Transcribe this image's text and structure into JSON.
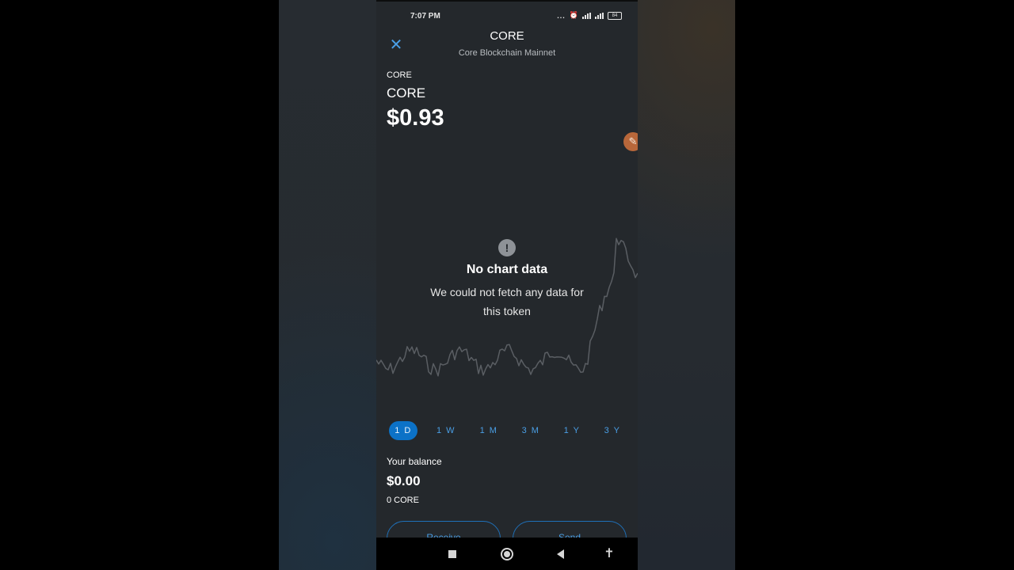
{
  "status_bar": {
    "time": "7:07 PM",
    "more": "...",
    "battery": "84"
  },
  "header": {
    "title": "CORE",
    "subtitle": "Core Blockchain Mainnet",
    "close_icon": "close-icon"
  },
  "token": {
    "symbol": "CORE",
    "name": "CORE",
    "price": "$0.93"
  },
  "chart": {
    "no_data_title": "No chart data",
    "no_data_message": "We could not fetch any data for this token",
    "line_color": "#5a5e63",
    "ranges": [
      "1 D",
      "1 W",
      "1 M",
      "3 M",
      "1 Y",
      "3 Y"
    ],
    "selected_range": "1 D"
  },
  "balance": {
    "label": "Your balance",
    "value": "$0.00",
    "amount": "0 CORE"
  },
  "actions": {
    "receive_label": "Receive",
    "send_label": "Send"
  },
  "colors": {
    "accent": "#4a9fe6",
    "active_tab_bg": "#0c72c7",
    "background": "#24282c"
  }
}
